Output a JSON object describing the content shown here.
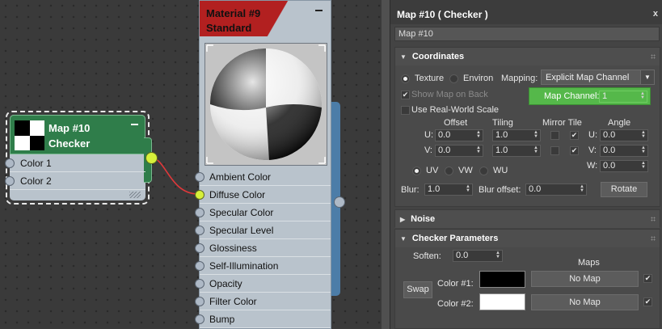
{
  "checker_node": {
    "title_line1": "Map #10",
    "title_line2": "Checker",
    "slots": [
      "Color 1",
      "Color 2"
    ]
  },
  "material_node": {
    "title_line1": "Material #9",
    "title_line2": "Standard",
    "slots": [
      "Ambient Color",
      "Diffuse Color",
      "Specular Color",
      "Specular Level",
      "Glossiness",
      "Self-Illumination",
      "Opacity",
      "Filter Color",
      "Bump"
    ]
  },
  "panel": {
    "title": "Map #10  ( Checker )",
    "close": "x",
    "name_value": "Map #10"
  },
  "coordinates": {
    "header": "Coordinates",
    "texture_label": "Texture",
    "environ_label": "Environ",
    "mapping_label": "Mapping:",
    "mapping_value": "Explicit Map Channel",
    "show_map_on_back": "Show Map on Back",
    "map_channel_label": "Map Channel:",
    "map_channel_value": "1",
    "use_real_world_scale": "Use Real-World Scale",
    "col_offset": "Offset",
    "col_tiling": "Tiling",
    "col_mirror_tile": "Mirror Tile",
    "col_angle": "Angle",
    "u_label": "U:",
    "v_label": "V:",
    "w_label": "W:",
    "u_offset": "0.0",
    "v_offset": "0.0",
    "u_tiling": "1.0",
    "v_tiling": "1.0",
    "u_angle": "0.0",
    "v_angle": "0.0",
    "w_angle": "0.0",
    "uv_label": "UV",
    "vw_label": "VW",
    "wu_label": "WU",
    "blur_label": "Blur:",
    "blur_value": "1.0",
    "blur_offset_label": "Blur offset:",
    "blur_offset_value": "0.0",
    "rotate_label": "Rotate"
  },
  "noise": {
    "header": "Noise"
  },
  "checker_params": {
    "header": "Checker Parameters",
    "soften_label": "Soften:",
    "soften_value": "0.0",
    "maps_label": "Maps",
    "swap_label": "Swap",
    "color1_label": "Color #1:",
    "color2_label": "Color #2:",
    "no_map_1": "No Map",
    "no_map_2": "No Map"
  },
  "colors": {
    "color1": "#000000",
    "color2": "#ffffff",
    "material_header": "#b22020",
    "checker_header": "#2f7d4a",
    "map_channel_bg": "#55b84a",
    "socket_active": "#d7f03a",
    "wire": "#e0383a"
  }
}
